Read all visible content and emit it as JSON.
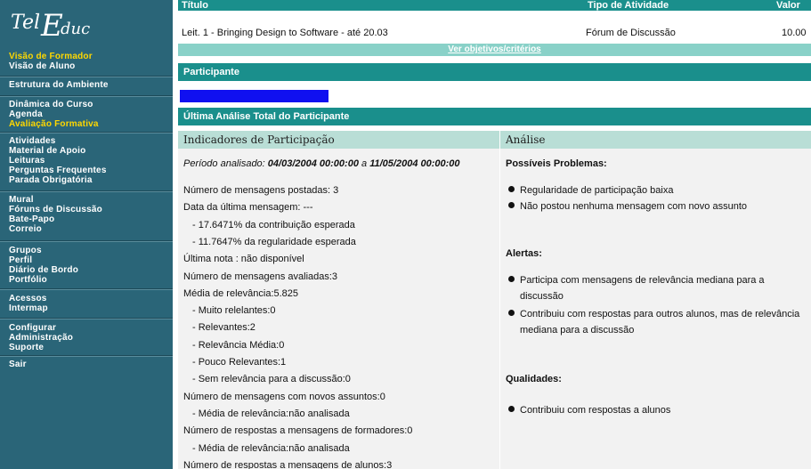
{
  "sidebar": {
    "logo_text": "TelEduc",
    "groups": [
      [
        "Visão de Formador",
        "Visão de Aluno"
      ],
      [
        "Estrutura do Ambiente"
      ],
      [
        "Dinâmica do Curso",
        "Agenda",
        "Avaliação Formativa"
      ],
      [
        "Atividades",
        "Material de Apoio",
        "Leituras",
        "Perguntas Frequentes",
        "Parada Obrigatória"
      ],
      [
        "Mural",
        "Fóruns de Discussão",
        "Bate-Papo",
        "Correio"
      ],
      [
        "Grupos",
        "Perfil",
        "Diário de Bordo",
        "Portfólio"
      ],
      [
        "Acessos",
        "Intermap"
      ],
      [
        "Configurar",
        "Administração",
        "Suporte"
      ],
      [
        "Sair"
      ]
    ]
  },
  "activity_table": {
    "headers": {
      "title": "Título",
      "type": "Tipo de Atividade",
      "value": "Valor"
    },
    "row": {
      "title": "Leit. 1 - Bringing Design to Software - até 20.03",
      "type": "Fórum de Discussão",
      "value": "10.00"
    },
    "objectives_link": "Ver objetivos/critérios"
  },
  "participant_header": "Participante",
  "last_analysis_header": "Última Análise Total do Participante",
  "indicators": {
    "header": "Indicadores de Participação",
    "period_label": "Período analisado:",
    "period_start": "04/03/2004 00:00:00",
    "period_connector": "a",
    "period_end": "11/05/2004 00:00:00",
    "lines": [
      {
        "text": "Número de mensagens postadas: 3",
        "sub": false
      },
      {
        "text": "Data da última mensagem: ---",
        "sub": false
      },
      {
        "text": "- 17.6471% da contribuição esperada",
        "sub": true
      },
      {
        "text": "- 11.7647% da regularidade esperada",
        "sub": true
      },
      {
        "text": "Última nota : não disponível",
        "sub": false
      },
      {
        "text": "Número de mensagens avaliadas:3",
        "sub": false
      },
      {
        "text": "Média de relevância:5.825",
        "sub": false
      },
      {
        "text": "- Muito relelantes:0",
        "sub": true
      },
      {
        "text": "- Relevantes:2",
        "sub": true
      },
      {
        "text": "- Relevância Média:0",
        "sub": true
      },
      {
        "text": "- Pouco Relevantes:1",
        "sub": true
      },
      {
        "text": "- Sem relevância para a discussão:0",
        "sub": true
      },
      {
        "text": "Número de mensagens com novos assuntos:0",
        "sub": false
      },
      {
        "text": "- Média de relevância:não analisada",
        "sub": true
      },
      {
        "text": "Número de respostas a mensagens de formadores:0",
        "sub": false
      },
      {
        "text": "- Média de relevância:não analisada",
        "sub": true
      },
      {
        "text": "Número de respostas a mensagens de alunos:3",
        "sub": false
      }
    ]
  },
  "analysis": {
    "header": "Análise",
    "problems_title": "Possíveis Problemas:",
    "problems": [
      "Regularidade de participação baixa",
      "Não postou nenhuma mensagem com novo assunto"
    ],
    "alerts_title": "Alertas:",
    "alerts": [
      "Participa com mensagens de relevância mediana para a discussão",
      "Contribuiu com respostas para outros alunos, mas de relevância mediana para a discussão"
    ],
    "qualities_title": "Qualidades:",
    "qualities": [
      "Contribuiu com respostas a alunos"
    ]
  }
}
